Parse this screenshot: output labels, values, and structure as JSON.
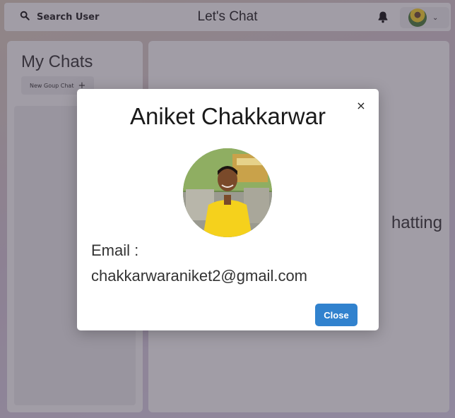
{
  "header": {
    "search_label": "Search User",
    "title": "Let's Chat"
  },
  "sidebar": {
    "title": "My Chats",
    "new_group_label": "New Goup Chat",
    "new_group_icon": "+"
  },
  "chatbox": {
    "hint_partial": "hatting"
  },
  "modal": {
    "name": "Aniket Chakkarwar",
    "email_label": "Email :",
    "email_value": "chakkarwaraniket2@gmail.com",
    "close_label": "Close",
    "close_x": "×"
  },
  "colors": {
    "primary_button": "#3182ce",
    "panel_bg": "#f4f4f5"
  }
}
